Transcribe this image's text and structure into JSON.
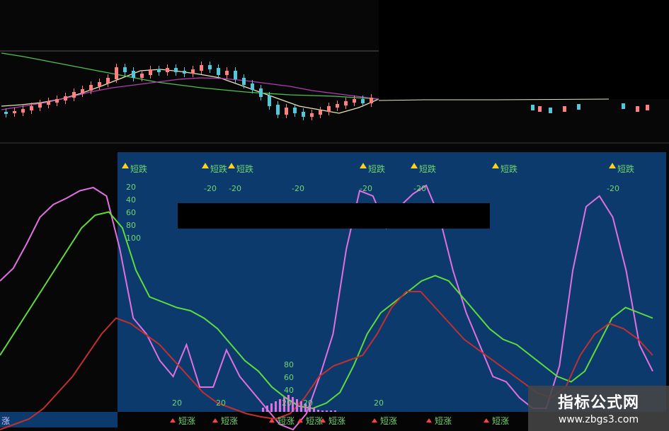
{
  "chart_data": [
    {
      "type": "candlestick",
      "title": "",
      "candles_shown": true,
      "moving_averages": [
        {
          "color": "#e6e6b4",
          "values": [
            150,
            148,
            145,
            140,
            132,
            122,
            111,
            100,
            98,
            101,
            105,
            110,
            120,
            130,
            140,
            150,
            155,
            160,
            152,
            140
          ]
        },
        {
          "color": "#4ec24e",
          "values": [
            75,
            80,
            86,
            92,
            98,
            104,
            110,
            116,
            120,
            124,
            127,
            130,
            132,
            134,
            135,
            136,
            138,
            140
          ]
        },
        {
          "color": "#b23cb2",
          "values": [
            155,
            150,
            145,
            138,
            130,
            124,
            120,
            116,
            112,
            110,
            111,
            114,
            118,
            122,
            128,
            132,
            136,
            140
          ]
        }
      ],
      "up_color": "#ff8080",
      "down_color": "#54c8d8"
    },
    {
      "type": "line",
      "title": "",
      "series": [
        {
          "color": "#e070e0",
          "values": [
            -90,
            -78,
            -55,
            -30,
            -18,
            -12,
            -5,
            -2,
            -10,
            -60,
            -125,
            -140,
            -165,
            -180,
            -150,
            -190,
            -190,
            -155,
            -180,
            -195,
            -210,
            -225,
            -230,
            -215,
            -180,
            -140,
            -60,
            -5,
            -10,
            -40,
            -20,
            -8,
            0,
            -30,
            -80,
            -120,
            -150,
            -180,
            -185,
            -200,
            -210,
            -210,
            -170,
            -80,
            -20,
            -10,
            -30,
            -80,
            -150,
            -175
          ]
        },
        {
          "color": "#5edc3c",
          "values": [
            -160,
            -140,
            -120,
            -100,
            -80,
            -60,
            -40,
            -28,
            -25,
            -40,
            -80,
            -105,
            -110,
            -115,
            -118,
            -125,
            -135,
            -150,
            -165,
            -175,
            -190,
            -200,
            -208,
            -210,
            -205,
            -195,
            -170,
            -140,
            -120,
            -110,
            -100,
            -90,
            -85,
            -90,
            -105,
            -120,
            -135,
            -145,
            -150,
            -160,
            -170,
            -180,
            -185,
            -175,
            -150,
            -125,
            -115,
            -120,
            -125
          ]
        },
        {
          "color": "#c03030",
          "values": [
            -230,
            -225,
            -220,
            -210,
            -195,
            -180,
            -160,
            -140,
            -125,
            -130,
            -140,
            -150,
            -165,
            -180,
            -195,
            -205,
            -210,
            -215,
            -218,
            -220,
            -215,
            -200,
            -180,
            -170,
            -165,
            -160,
            -140,
            -115,
            -100,
            -100,
            -115,
            -130,
            -145,
            -155,
            -165,
            -175,
            -185,
            -195,
            -200,
            -190,
            -160,
            -140,
            -130,
            -135,
            -145,
            -160
          ]
        }
      ],
      "tick_labels_upper": [
        "20",
        "40",
        "60",
        "80",
        "100"
      ],
      "tick_labels_repeated": [
        "-20",
        "-20",
        "-20",
        "-20",
        "-20",
        "-20",
        "-20",
        "-20"
      ],
      "tick_labels_lower": [
        "80",
        "60",
        "40",
        "20",
        "20",
        "20",
        "20",
        "20"
      ],
      "sell_signal_label": "短跌",
      "buy_signal_label": "短涨",
      "sell_signal_count": 8,
      "buy_signal_count": 10
    }
  ],
  "watermark": {
    "title": "指标公式网",
    "url": "www.zbgs3.com"
  },
  "status_label": "涨"
}
